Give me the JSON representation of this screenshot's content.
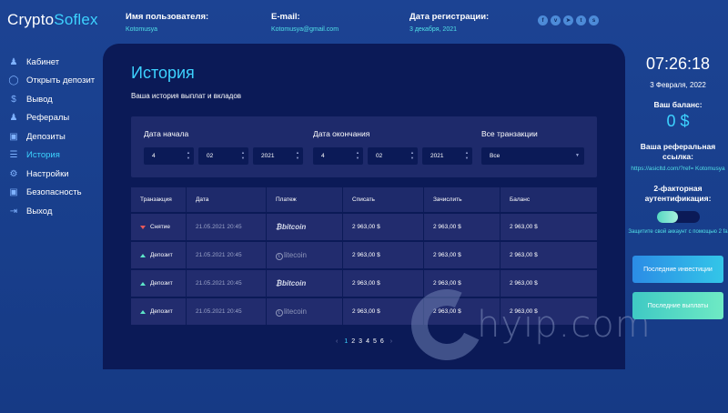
{
  "brand": {
    "part1": "Crypto",
    "part2": "Soflex"
  },
  "header": {
    "username_label": "Имя пользователя:",
    "username_value": "Kotomusya",
    "email_label": "E-mail:",
    "email_value": "Kotomusya@gmail.com",
    "regdate_label": "Дата регистрации:",
    "regdate_value": "3 декабря, 2021"
  },
  "socials": [
    "facebook-icon",
    "vk-icon",
    "telegram-icon",
    "twitter-icon",
    "skype-icon"
  ],
  "sidebar": {
    "items": [
      {
        "label": "Кабинет",
        "icon": "user-icon"
      },
      {
        "label": "Открыть депозит",
        "icon": "coins-icon"
      },
      {
        "label": "Вывод",
        "icon": "dollar-icon"
      },
      {
        "label": "Рефералы",
        "icon": "users-icon"
      },
      {
        "label": "Депозиты",
        "icon": "monitor-icon"
      },
      {
        "label": "История",
        "icon": "document-icon"
      },
      {
        "label": "Настройки",
        "icon": "gear-icon"
      },
      {
        "label": "Безопасность",
        "icon": "lock-icon"
      },
      {
        "label": "Выход",
        "icon": "logout-icon"
      }
    ]
  },
  "main": {
    "title": "История",
    "subtitle": "Ваша история выплат и вкладов",
    "filters": {
      "start_label": "Дата начала",
      "end_label": "Дата окончания",
      "type_label": "Все транзакции",
      "start_day": "4",
      "start_month": "02",
      "start_year": "2021",
      "end_day": "4",
      "end_month": "02",
      "end_year": "2021",
      "type_value": "Все"
    },
    "table": {
      "headers": [
        "Транзакция",
        "Дата",
        "Платеж",
        "Списать",
        "Зачислить",
        "Баланс"
      ],
      "rows": [
        {
          "type": "Снятие",
          "direction": "out",
          "date": "21.05.2021 20:45",
          "payment": "bitcoin",
          "debit": "2 963,00 $",
          "credit": "2 963,00 $",
          "balance": "2 963,00 $"
        },
        {
          "type": "Депозит",
          "direction": "in",
          "date": "21.05.2021 20:45",
          "payment": "litecoin",
          "debit": "2 963,00 $",
          "credit": "2 963,00 $",
          "balance": "2 963,00 $"
        },
        {
          "type": "Депозит",
          "direction": "in",
          "date": "21.05.2021 20:45",
          "payment": "bitcoin",
          "debit": "2 963,00 $",
          "credit": "2 963,00 $",
          "balance": "2 963,00 $"
        },
        {
          "type": "Депозит",
          "direction": "in",
          "date": "21.05.2021 20:45",
          "payment": "litecoin",
          "debit": "2 963,00 $",
          "credit": "2 963,00 $",
          "balance": "2 963,00 $"
        }
      ]
    },
    "pagination": {
      "prev": "‹",
      "pages": [
        "1",
        "2",
        "3",
        "4",
        "5",
        "6"
      ],
      "current": "1",
      "next": "›"
    }
  },
  "watermark": {
    "text": "hyip.com"
  },
  "right": {
    "clock": "07:26:18",
    "date": "3 Февраля, 2022",
    "balance_label": "Ваш баланс:",
    "balance_value": "0 $",
    "ref_label": "Ваша реферальная ссылка:",
    "ref_value": "https://asicltd.com/?ref= Kotomusya",
    "twofa_label": "2-факторная аутентификация:",
    "protect_text": "Защитите свой аккаунт с помощью 2 fa",
    "btn_investments": "Последние инвестиции",
    "btn_payouts": "Последние выплаты"
  },
  "colors": {
    "accent": "#3dd2ff",
    "background": "#1c4393",
    "panel": "#0b1a57",
    "teal": "#52e0e6",
    "out": "#ea5a5a",
    "in": "#5de6c8"
  }
}
